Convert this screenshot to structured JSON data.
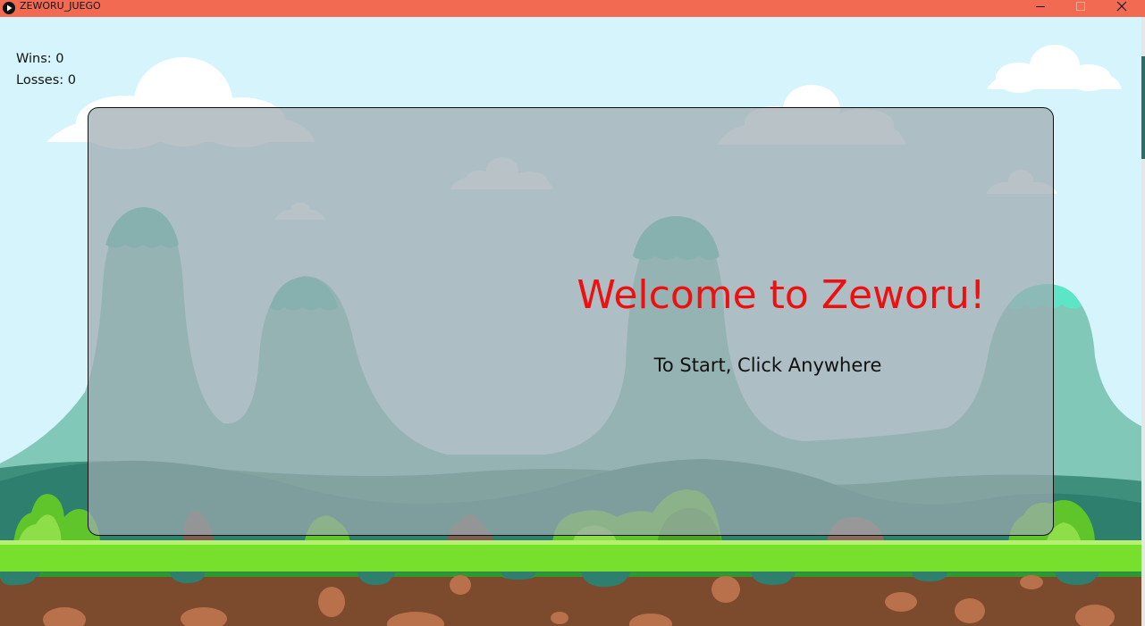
{
  "window": {
    "title": "ZEWORU_JUEGO",
    "app_icon": "play-circle-icon",
    "controls": [
      "minimize-icon",
      "maximize-icon",
      "close-icon"
    ],
    "titlebar_color": "#f26a52"
  },
  "score": {
    "wins_label": "Wins:",
    "wins_value": "0",
    "losses_label": "Losses:",
    "losses_value": "0"
  },
  "menu": {
    "title": "Welcome to Zeworu!",
    "subtitle": "To Start, Click Anywhere",
    "title_color": "#ee1010"
  },
  "colors": {
    "sky": "#d5f4fb",
    "grass": "#76e02c",
    "dirt": "#7c4a2d",
    "mountain": "#82c8b9",
    "mountain_cap": "#4cc0a8",
    "cloud": "#ffffff"
  }
}
